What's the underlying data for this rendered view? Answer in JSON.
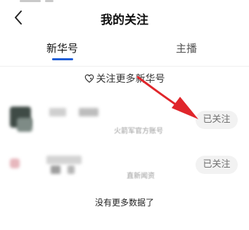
{
  "nav": {
    "title": "我的关注",
    "back_icon": "chevron-left-icon"
  },
  "tabs": [
    {
      "label": "新华号",
      "active": true
    },
    {
      "label": "主播",
      "active": false
    }
  ],
  "follow_more": {
    "label": "关注更多新华号",
    "icon": "heart-icon"
  },
  "accounts": [
    {
      "desc": "火箭军官方账号",
      "follow_label": "已关注"
    },
    {
      "desc": "直新闻资",
      "follow_label": "已关注"
    }
  ],
  "annotation": {
    "arrow_color": "#e0262b",
    "points_to": "已关注"
  },
  "footer": {
    "no_more": "没有更多数据了"
  },
  "colors": {
    "accent": "#1c5bd6",
    "pill_bg": "#f2f2f2",
    "pill_text": "#6f6f6f"
  }
}
